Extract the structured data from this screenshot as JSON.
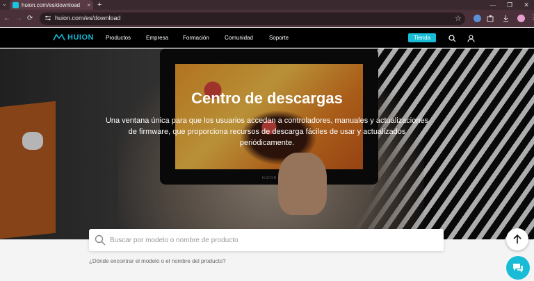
{
  "browser": {
    "tab_title": "huion.com/es/download",
    "tab_close": "×",
    "new_tab": "+",
    "tab_list": "⌄",
    "back": "←",
    "forward": "→",
    "reload": "⟳",
    "url": "huion.com/es/download",
    "star": "☆",
    "minimize": "—",
    "restore": "❐",
    "close": "✕",
    "menu": "⋮"
  },
  "header": {
    "logo_text": "HUION",
    "nav": [
      "Productos",
      "Empresa",
      "Formación",
      "Comunidad",
      "Soporte"
    ],
    "store_button": "Tienda",
    "accent": "#18bcd6"
  },
  "hero": {
    "tablet_brand": "HUION",
    "title": "Centro de descargas",
    "description": "Una ventana única para que los usuarios accedan a controladores, manuales y actualizaciones de firmware, que proporciona recursos de descarga fáciles de usar y actualizados periódicamente."
  },
  "search": {
    "placeholder": "Buscar por modelo o nombre de producto",
    "help_link": "¿Dónde encontrar el modelo o el nombre del producto?"
  }
}
